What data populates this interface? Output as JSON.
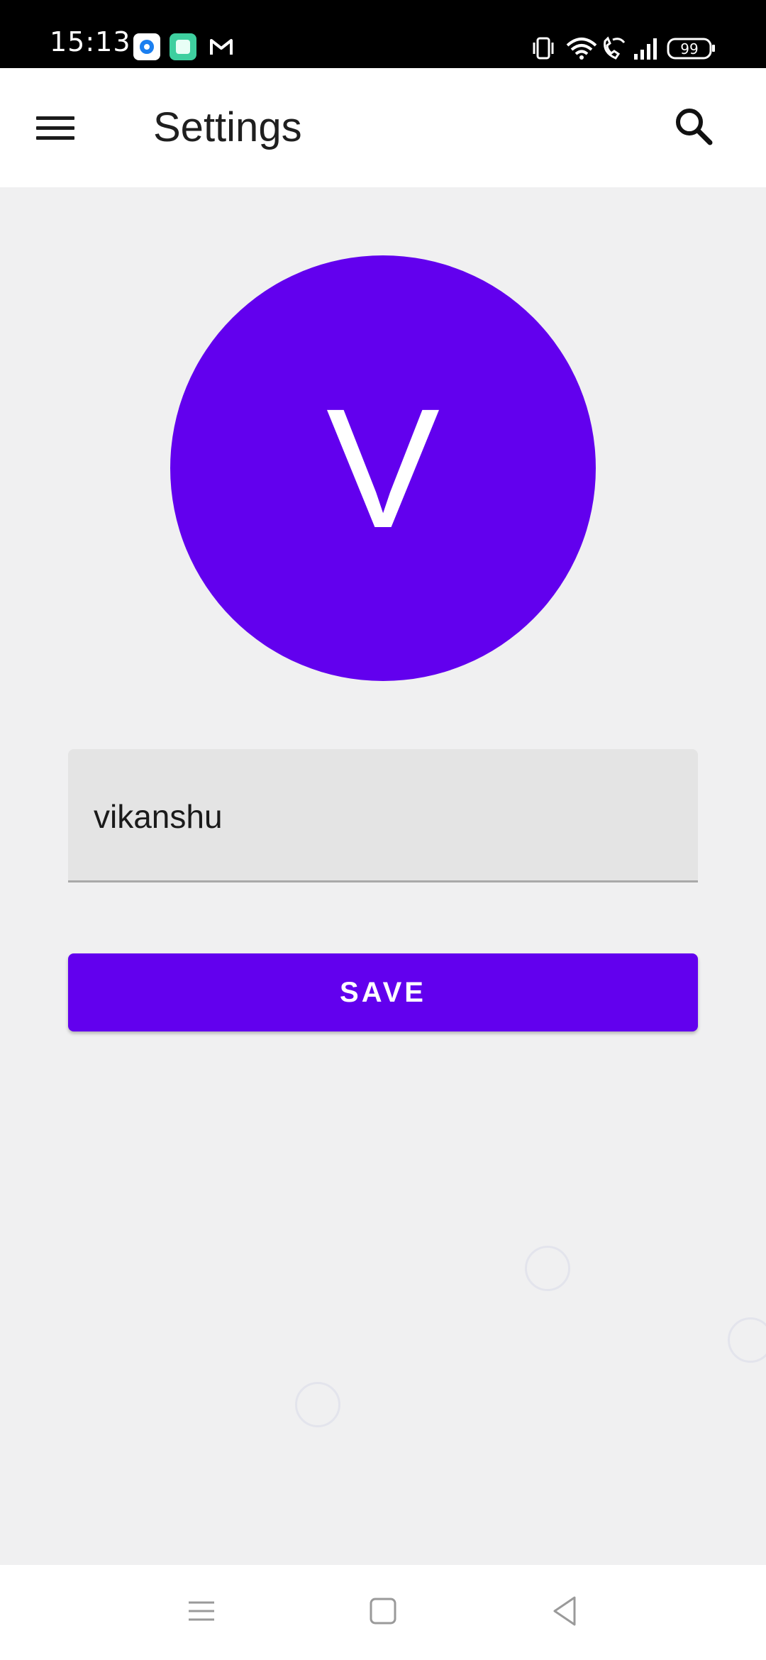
{
  "status_bar": {
    "time": "15:13",
    "battery": "99",
    "notification_icons": [
      "app-blue-icon",
      "app-green-icon",
      "gmail-icon"
    ],
    "system_icons": [
      "vibrate-icon",
      "wifi-icon",
      "wifi-calling-icon",
      "signal-icon",
      "battery-icon"
    ]
  },
  "app_bar": {
    "title": "Settings",
    "menu_icon": "hamburger-menu-icon",
    "search_icon": "search-icon"
  },
  "profile": {
    "avatar_letter": "V",
    "avatar_color": "#6200ee"
  },
  "form": {
    "name_value": "vikanshu",
    "save_label": "SAVE"
  },
  "nav_bar": {
    "items": [
      "recents-icon",
      "home-icon",
      "back-icon"
    ]
  }
}
